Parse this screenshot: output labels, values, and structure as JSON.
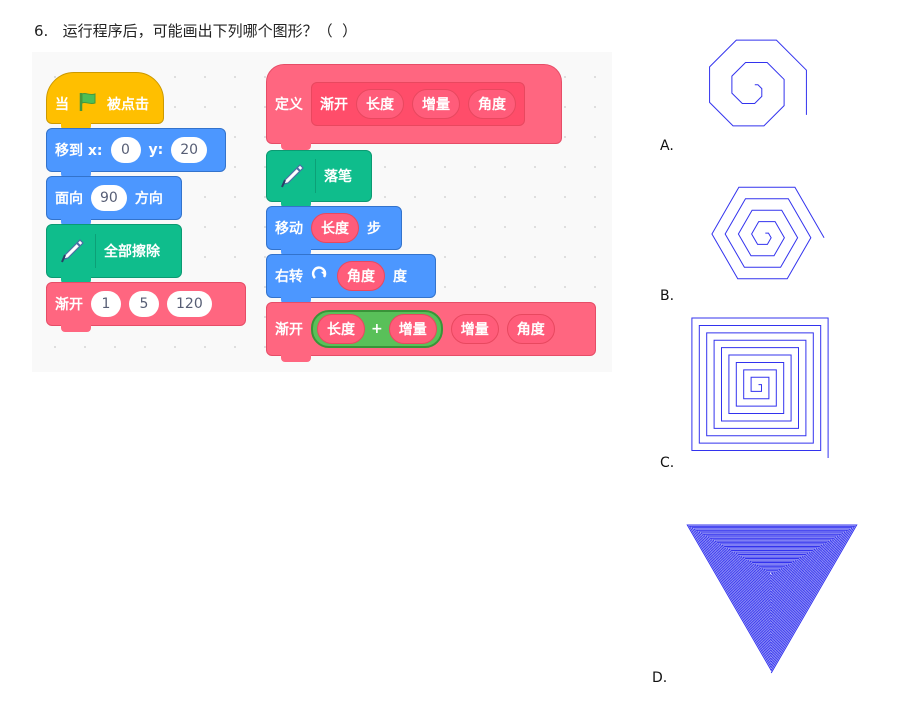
{
  "question": {
    "number": "6.",
    "text": "运行程序后，可能画出下列哪个图形？（  ）"
  },
  "colors": {
    "event": "#ffbf00",
    "motion": "#4c97ff",
    "pen": "#0fbd8c",
    "custom": "#ff6680",
    "operator": "#59c059",
    "figure_line": "#3333ee"
  },
  "main_script": {
    "flag_block": {
      "label_left": "当",
      "icon": "green-flag-icon",
      "label_right": "被点击"
    },
    "goto_block": {
      "label": "移到 x:",
      "x_value": "0",
      "y_label": "y:",
      "y_value": "20"
    },
    "direction_block": {
      "label_left": "面向",
      "value": "90",
      "label_right": "方向"
    },
    "clear_block": {
      "icon": "pen-icon",
      "label": "全部擦除"
    },
    "call_block": {
      "label": "渐开",
      "args": [
        "1",
        "5",
        "120"
      ]
    }
  },
  "define_script": {
    "define_block": {
      "label": "定义",
      "name": "渐开",
      "params": [
        "长度",
        "增量",
        "角度"
      ]
    },
    "pen_down_block": {
      "icon": "pen-icon",
      "label": "落笔"
    },
    "move_block": {
      "label_left": "移动",
      "param": "长度",
      "label_right": "步"
    },
    "turn_block": {
      "label_left": "右转",
      "icon": "rotate-right-icon",
      "param": "角度",
      "label_right": "度"
    },
    "recurse_block": {
      "label": "渐开",
      "sum_left": "长度",
      "sum_op": "+",
      "sum_right": "增量",
      "arg2": "增量",
      "arg3": "角度"
    }
  },
  "options": [
    {
      "label": "A.",
      "shape": "octagon-spiral"
    },
    {
      "label": "B.",
      "shape": "hexagon-spiral"
    },
    {
      "label": "C.",
      "shape": "square-spiral"
    },
    {
      "label": "D.",
      "shape": "triangle-spiral"
    }
  ]
}
